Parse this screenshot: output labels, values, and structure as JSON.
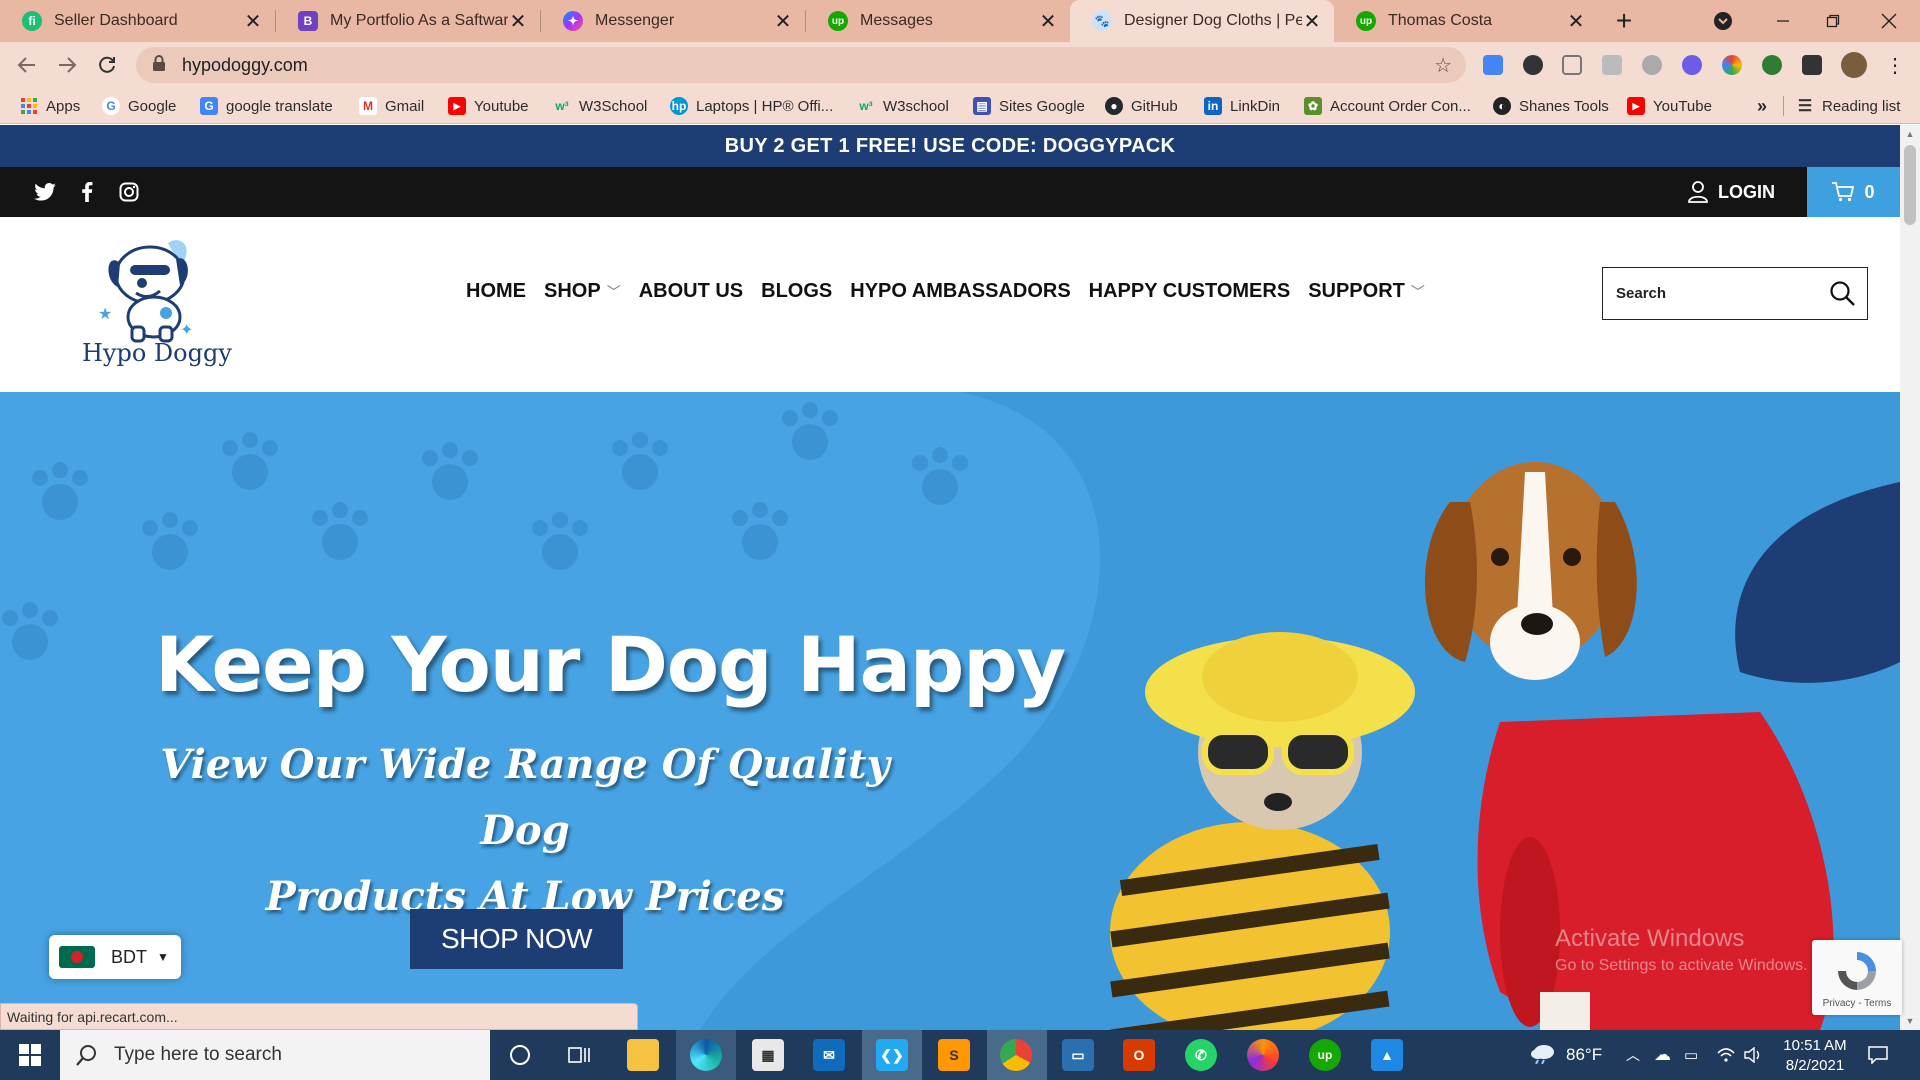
{
  "browser": {
    "tabs": [
      {
        "title": "Seller Dashboard",
        "color": "#1dbf73",
        "glyph": "fi"
      },
      {
        "title": "My Portfolio As a Saftware E",
        "color": "#6f42c1",
        "glyph": "B"
      },
      {
        "title": "Messenger",
        "color": "#a033ff",
        "glyph": "m"
      },
      {
        "title": "Messages",
        "color": "#14a800",
        "glyph": "up"
      },
      {
        "title": "Designer Dog Cloths | Pet A",
        "color": "#7aa7d6",
        "glyph": "d"
      },
      {
        "title": "Thomas Costa",
        "color": "#14a800",
        "glyph": "up"
      }
    ],
    "close_glyph": "✕",
    "new_tab_glyph": "+",
    "url": "hypodoggy.com",
    "bookmarks": [
      {
        "label": "Apps",
        "icon": "apps-icon",
        "color": "#e94235"
      },
      {
        "label": "Google",
        "icon": "google-icon",
        "color": "#4285f4"
      },
      {
        "label": "google translate",
        "icon": "translate-icon",
        "color": "#4285f4"
      },
      {
        "label": "Gmail",
        "icon": "gmail-icon",
        "color": "#d93025"
      },
      {
        "label": "Youtube",
        "icon": "youtube-icon",
        "color": "#ff0000"
      },
      {
        "label": "W3School",
        "icon": "w3school-icon",
        "color": "#04aa6d"
      },
      {
        "label": "Laptops | HP® Offi...",
        "icon": "hp-icon",
        "color": "#0096d6"
      },
      {
        "label": "W3school",
        "icon": "w3school-icon",
        "color": "#04aa6d"
      },
      {
        "label": "Sites Google",
        "icon": "sites-icon",
        "color": "#3f51b5"
      },
      {
        "label": "GitHub",
        "icon": "github-icon",
        "color": "#24292e"
      },
      {
        "label": "LinkDin",
        "icon": "linkedin-icon",
        "color": "#0a66c2"
      },
      {
        "label": "Account Order Con...",
        "icon": "extension-icon",
        "color": "#5a8f29"
      },
      {
        "label": "Shanes Tools",
        "icon": "tools-icon",
        "color": "#222222"
      },
      {
        "label": "YouTube",
        "icon": "youtube-icon",
        "color": "#ff0000"
      }
    ],
    "overflow_label": "»",
    "reading_list_label": "Reading list",
    "status_text": "Waiting for api.recart.com..."
  },
  "site": {
    "promo_text": "BUY 2 GET 1 FREE! USE CODE: DOGGYPACK",
    "login_label": "LOGIN",
    "cart_count": "0",
    "logo_text": "Hypo Doggy",
    "menu": [
      {
        "label": "HOME",
        "dropdown": false
      },
      {
        "label": "SHOP",
        "dropdown": true
      },
      {
        "label": "ABOUT US",
        "dropdown": false
      },
      {
        "label": "BLOGS",
        "dropdown": false
      },
      {
        "label": "HYPO AMBASSADORS",
        "dropdown": false
      },
      {
        "label": "HAPPY CUSTOMERS",
        "dropdown": false
      },
      {
        "label": "SUPPORT",
        "dropdown": true
      }
    ],
    "search_placeholder": "Search",
    "hero": {
      "title": "Keep Your Dog Happy",
      "subtitle_line1": "View Our Wide Range Of Quality Dog",
      "subtitle_line2": "Products At Low Prices",
      "cta": "SHOP NOW"
    },
    "currency": "BDT",
    "colors": {
      "navy": "#1d3d74",
      "sky": "#47a3e3",
      "cart": "#3fa0df"
    }
  },
  "overlay": {
    "activate_line1": "Activate Windows",
    "activate_line2": "Go to Settings to activate Windows.",
    "recaptcha_links": "Privacy - Terms"
  },
  "taskbar": {
    "search_placeholder": "Type here to search",
    "weather": "86°F",
    "time": "10:51 AM",
    "date": "8/2/2021"
  }
}
